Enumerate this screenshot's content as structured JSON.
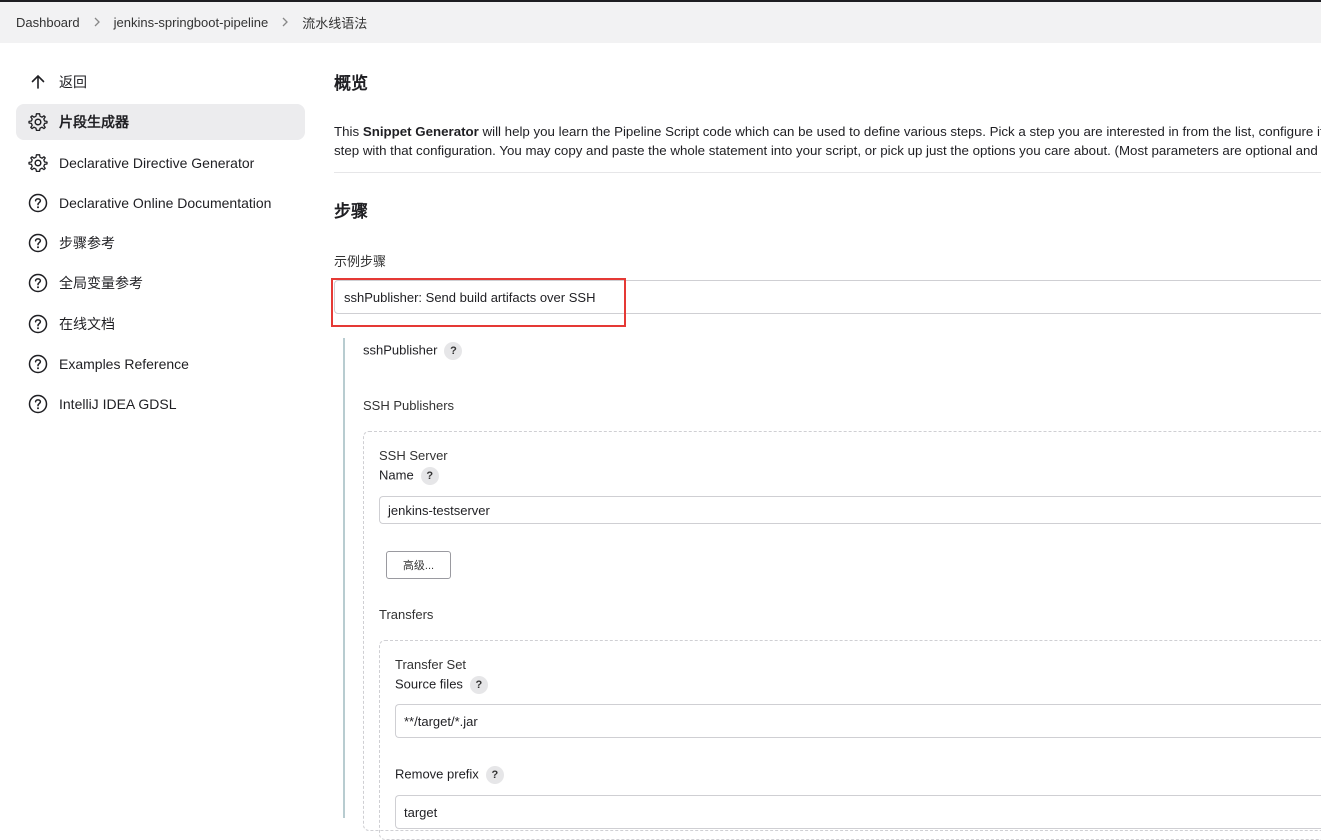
{
  "breadcrumb": {
    "items": [
      "Dashboard",
      "jenkins-springboot-pipeline",
      "流水线语法"
    ],
    "separator": ">"
  },
  "sidebar": {
    "items": [
      {
        "label": "返回",
        "icon": "arrow-up-icon",
        "active": false
      },
      {
        "label": "片段生成器",
        "icon": "gear-icon",
        "active": true
      },
      {
        "label": "Declarative Directive Generator",
        "icon": "gear-icon",
        "active": false
      },
      {
        "label": "Declarative Online Documentation",
        "icon": "help-circle-icon",
        "active": false
      },
      {
        "label": "步骤参考",
        "icon": "help-circle-icon",
        "active": false
      },
      {
        "label": "全局变量参考",
        "icon": "help-circle-icon",
        "active": false
      },
      {
        "label": "在线文档",
        "icon": "help-circle-icon",
        "active": false
      },
      {
        "label": "Examples Reference",
        "icon": "help-circle-icon",
        "active": false
      },
      {
        "label": "IntelliJ IDEA GDSL",
        "icon": "help-circle-icon",
        "active": false
      }
    ]
  },
  "main": {
    "overview_title": "概览",
    "intro_prefix": "This ",
    "intro_bold": "Snippet Generator",
    "intro_line1_rest": " will help you learn the Pipeline Script code which can be used to define various steps. Pick a step you are interested in from the list, configure it, cl",
    "intro_line2": "step with that configuration. You may copy and paste the whole statement into your script, or pick up just the options you care about. (Most parameters are optional and c",
    "steps_title": "步骤",
    "sample_step_label": "示例步骤",
    "sample_step_value": "sshPublisher: Send build artifacts over SSH",
    "step_name": "sshPublisher",
    "help_glyph": "?",
    "ssh_publishers_label": "SSH Publishers",
    "ssh_server_label": "SSH Server",
    "name_label": "Name",
    "name_value": "jenkins-testserver",
    "advanced_button": "高级...",
    "transfers_label": "Transfers",
    "transfer_set_label": "Transfer Set",
    "source_files_label": "Source files",
    "source_files_value": "**/target/*.jar",
    "remove_prefix_label": "Remove prefix",
    "remove_prefix_value": "target"
  },
  "colors": {
    "highlight_box": "#e53935",
    "topbar_bg": "#f2f2f3",
    "active_item_bg": "#ececee",
    "step_guide_line": "#b8ccd0"
  }
}
